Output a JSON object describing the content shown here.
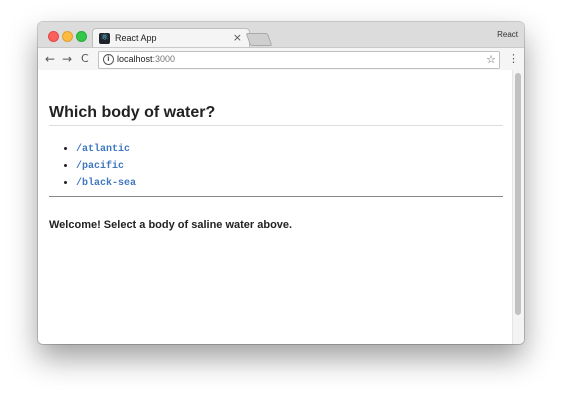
{
  "browser": {
    "tab": {
      "title": "React App",
      "favicon": "react-logo-icon",
      "close_glyph": "×"
    },
    "profile_label": "React",
    "nav": {
      "back_glyph": "←",
      "forward_glyph": "→",
      "reload_glyph": "C"
    },
    "address": {
      "host": "localhost",
      "port": ":3000",
      "info_glyph": "i",
      "star_glyph": "☆"
    },
    "menu_glyph": "⋮"
  },
  "page": {
    "heading": "Which body of water?",
    "links": [
      {
        "label": "/atlantic"
      },
      {
        "label": "/pacific"
      },
      {
        "label": "/black-sea"
      }
    ],
    "welcome": "Welcome! Select a body of saline water above."
  },
  "colors": {
    "link": "#4078c0",
    "traffic_close": "#fc605c",
    "traffic_minimize": "#fdbc40",
    "traffic_maximize": "#34c84a"
  }
}
